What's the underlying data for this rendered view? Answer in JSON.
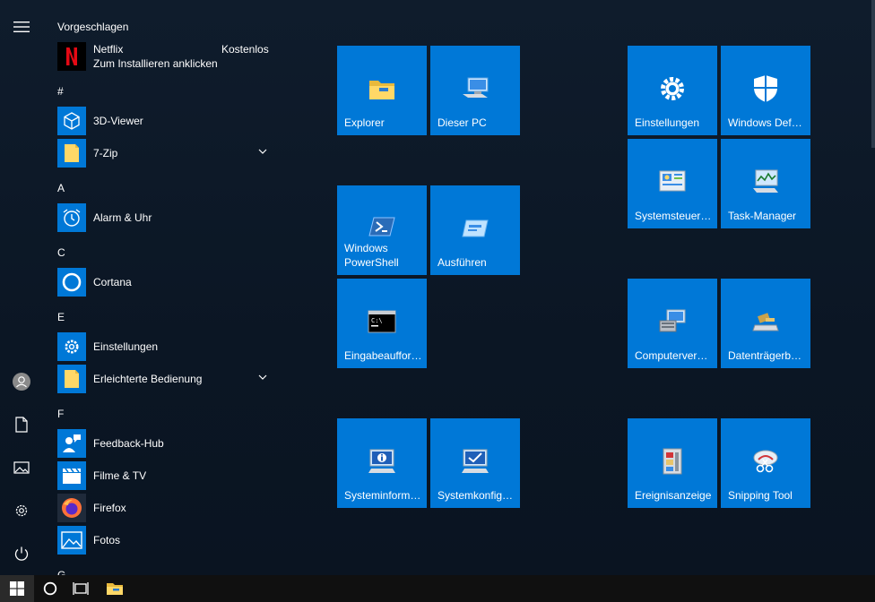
{
  "suggested": {
    "title": "Vorgeschlagen",
    "app_name": "Netflix",
    "price": "Kostenlos",
    "subtitle": "Zum Installieren anklicken"
  },
  "letters": [
    "#",
    "A",
    "C",
    "E",
    "F",
    "G"
  ],
  "apps": [
    {
      "label": "3D-Viewer",
      "icon": "cube-icon"
    },
    {
      "label": "7-Zip",
      "icon": "folder-icon"
    },
    {
      "label": "Alarm & Uhr",
      "icon": "alarm-clock-icon"
    },
    {
      "label": "Cortana",
      "icon": "cortana-ring-icon"
    },
    {
      "label": "Einstellungen",
      "icon": "gear-icon"
    },
    {
      "label": "Erleichterte Bedienung",
      "icon": "folder-icon"
    },
    {
      "label": "Feedback-Hub",
      "icon": "feedback-person-icon"
    },
    {
      "label": "Filme & TV",
      "icon": "clapperboard-icon"
    },
    {
      "label": "Firefox",
      "icon": "firefox-icon"
    },
    {
      "label": "Fotos",
      "icon": "photo-icon"
    }
  ],
  "tiles": [
    {
      "label": "Explorer",
      "icon": "folder-icon"
    },
    {
      "label": "Dieser PC",
      "icon": "computer-icon"
    },
    {
      "label": "Einstellungen",
      "icon": "gear-icon"
    },
    {
      "label": "Windows Def…",
      "icon": "shield-icon"
    },
    {
      "label": "Systemsteuer…",
      "icon": "control-panel-icon"
    },
    {
      "label": "Task-Manager",
      "icon": "task-manager-icon"
    },
    {
      "label": "Windows PowerShell",
      "icon": "powershell-icon"
    },
    {
      "label": "Ausführen",
      "icon": "run-icon"
    },
    {
      "label": "Eingabeauffor…",
      "icon": "command-prompt-icon"
    },
    {
      "label": "Computerver…",
      "icon": "computer-management-icon"
    },
    {
      "label": "Datenträgerb…",
      "icon": "disk-cleanup-icon"
    },
    {
      "label": "Systeminform…",
      "icon": "system-info-icon"
    },
    {
      "label": "Systemkonfig…",
      "icon": "system-config-icon"
    },
    {
      "label": "Ereignisanzeige",
      "icon": "event-viewer-icon"
    },
    {
      "label": "Snipping Tool",
      "icon": "snipping-tool-icon"
    }
  ],
  "rail": [
    "hamburger-icon",
    "user-icon",
    "document-icon",
    "pictures-icon",
    "gear-icon",
    "power-icon"
  ],
  "taskbar": [
    "windows-logo-icon",
    "cortana-icon",
    "task-view-icon",
    "file-explorer-icon"
  ],
  "colors": {
    "tile": "#0078d7",
    "background": "#0f1c2c",
    "taskbar": "#101010"
  }
}
